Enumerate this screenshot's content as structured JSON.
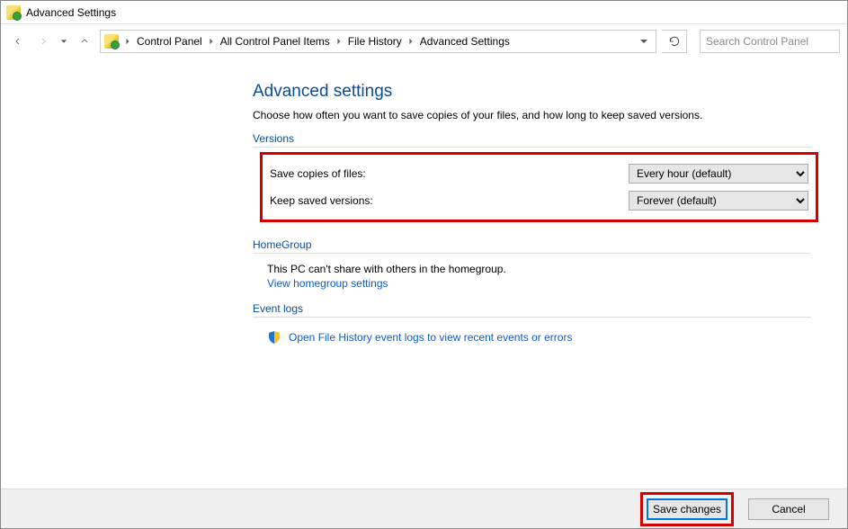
{
  "window": {
    "title": "Advanced Settings"
  },
  "breadcrumb": {
    "items": [
      "Control Panel",
      "All Control Panel Items",
      "File History",
      "Advanced Settings"
    ]
  },
  "search": {
    "placeholder": "Search Control Panel"
  },
  "page": {
    "title": "Advanced settings",
    "subtitle": "Choose how often you want to save copies of your files, and how long to keep saved versions."
  },
  "versions": {
    "heading": "Versions",
    "save_label": "Save copies of files:",
    "save_value": "Every hour (default)",
    "keep_label": "Keep saved versions:",
    "keep_value": "Forever (default)"
  },
  "homegroup": {
    "heading": "HomeGroup",
    "text": "This PC can't share with others in the homegroup.",
    "link": "View homegroup settings"
  },
  "eventlogs": {
    "heading": "Event logs",
    "link": "Open File History event logs to view recent events or errors"
  },
  "footer": {
    "save": "Save changes",
    "cancel": "Cancel"
  }
}
